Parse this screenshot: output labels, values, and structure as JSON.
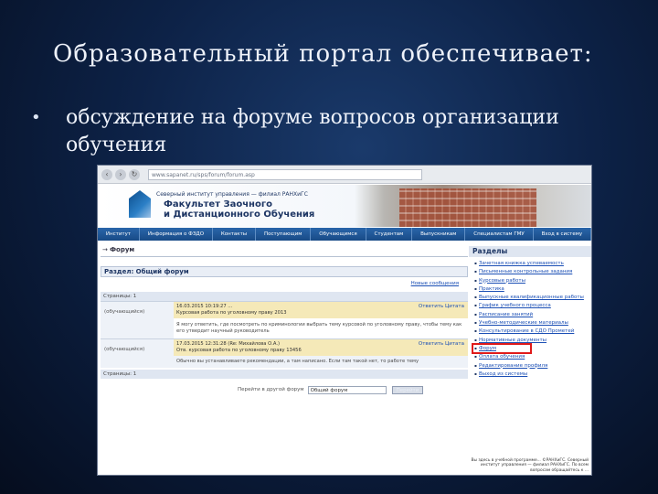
{
  "slide": {
    "title": "Образовательный портал обеспечивает:",
    "bullet": "обсуждение на форуме вопросов организации обучения",
    "bullet_symbol": "•"
  },
  "browser": {
    "address": "www.sapanet.ru/sps/forum/forum.asp",
    "header": {
      "subtitle": "Северный институт управления — филиал РАНХиГС",
      "name_line1": "Факультет Заочного",
      "name_line2": "и Дистанционного Обучения"
    },
    "topnav": [
      "Институт",
      "Информация о ФЗДО",
      "Контакты",
      "Поступающим",
      "Обучающимся",
      "Студентам",
      "Выпускникам",
      "Специалистам ГМУ",
      "Вход в систему"
    ],
    "breadcrumb_arrow": "→",
    "breadcrumb": "Форум",
    "section_title": "Раздел: Общий форум",
    "subscribe": "Новые сообщения",
    "pager_top": "Страницы: 1",
    "posts": [
      {
        "author": "(обучающийся)",
        "head": "16.03.2015 10:19:27 ...",
        "subhead": "Курсовая работа по уголовному праву 2013",
        "text": "Я могу ответить, где посмотреть по криминологии выбрать тему курсовой по уголовному праву, чтобы тему как его утвердит научный руководитель",
        "actions": "Ответить   Цитата"
      },
      {
        "author": "(обучающийся)",
        "head": "17.03.2015 12:31:28 (Re: Михайлова О.А.)",
        "subhead": "Отв. курсовая работа по уголовному праву 13456",
        "text": "Обычно вы устанавливаете рекомендации, а там написано. Если там такой нет, то работе тему",
        "actions": "Ответить   Цитата"
      }
    ],
    "pager_bottom": "Страницы: 1",
    "move_label": "Перейти в другой форум",
    "move_select": "Общий форум",
    "move_button": "Перейти",
    "sidebar": {
      "title": "Разделы",
      "items": [
        "Зачетная книжка успеваемость",
        "Письменные контрольные задания",
        "Курсовые работы",
        "Практика",
        "Выпускные квалификационные работы",
        "График учебного процесса",
        "Расписание занятий",
        "Учебно-методические материалы",
        "Консультирование в СДО Прометей",
        "Нормативные документы",
        "Форум",
        "Оплата обучения",
        "Редактирование профиля",
        "Выход из системы"
      ],
      "highlighted_index": 10,
      "footer": "Вы здесь в учебной программе... ©РАНХиГС. Северный институт управления — филиал РАНХиГС. По всем вопросам обращайтесь к ..."
    }
  },
  "colors": {
    "background": "#0d2247",
    "nav": "#1f5597",
    "highlight": "#e01b1b"
  }
}
